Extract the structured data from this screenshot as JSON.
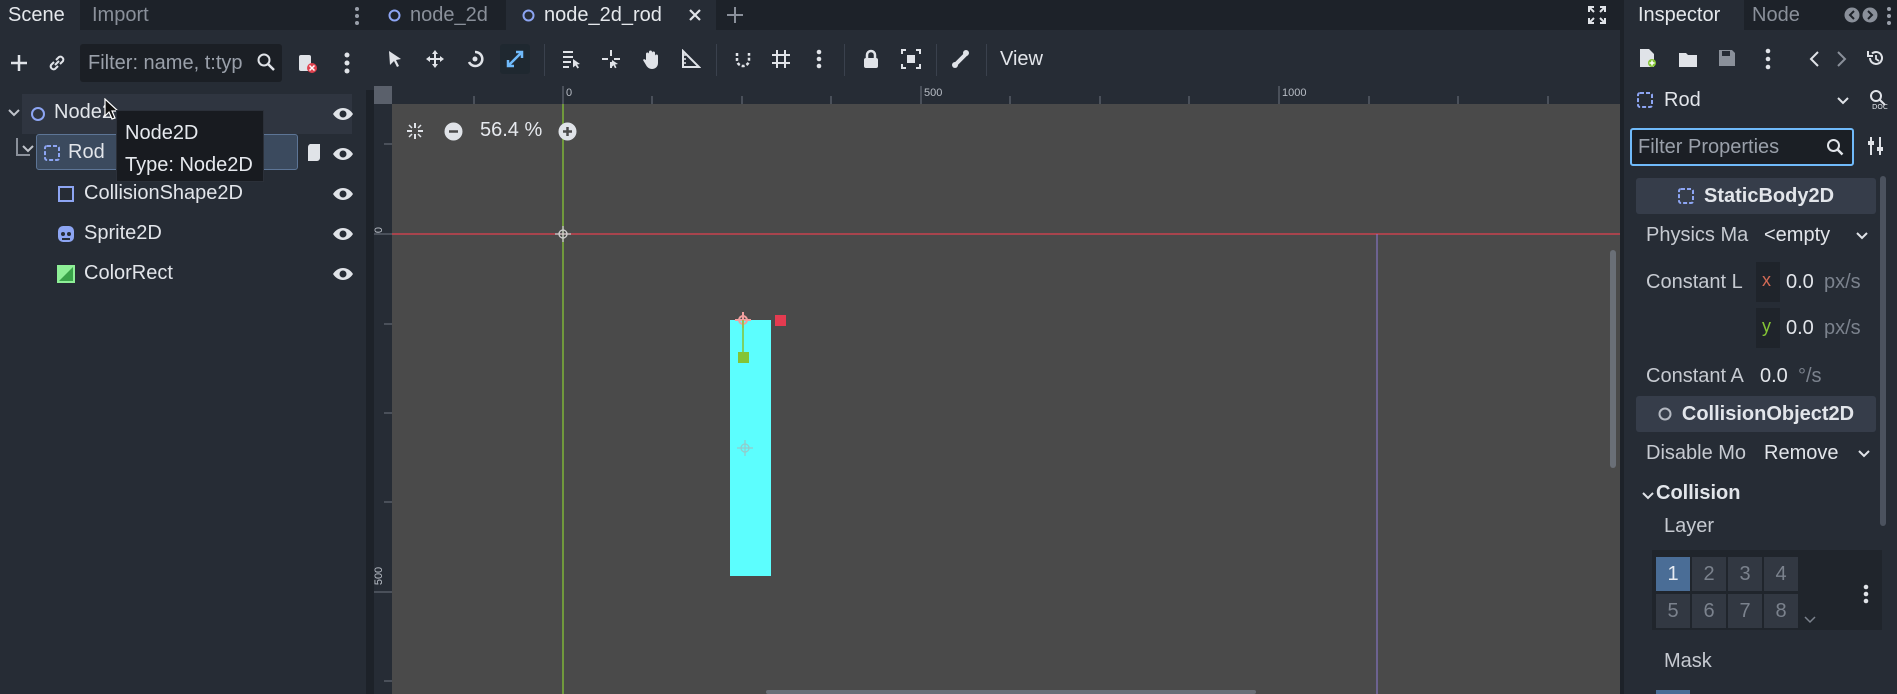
{
  "left_dock": {
    "tabs": [
      "Scene",
      "Import"
    ],
    "filter_placeholder": "Filter: name, t:typ",
    "tree": [
      {
        "label": "Node2",
        "icon": "node2d-icon"
      },
      {
        "label": "Rod",
        "icon": "staticbody2d-icon"
      },
      {
        "label": "CollisionShape2D",
        "icon": "collisionshape2d-icon"
      },
      {
        "label": "Sprite2D",
        "icon": "sprite2d-icon"
      },
      {
        "label": "ColorRect",
        "icon": "colorrect-icon"
      }
    ],
    "tooltip": {
      "line1": "Node2D",
      "line2": "Type: Node2D"
    }
  },
  "editor": {
    "scene_tabs": [
      "node_2d",
      "node_2d_rod"
    ],
    "view_menu": "View",
    "zoom_label": "56.4 %",
    "ruler_top_labels": [
      "0",
      "500",
      "1000"
    ],
    "ruler_left_labels": [
      "0",
      "500"
    ]
  },
  "inspector": {
    "tabs": [
      "Inspector",
      "Node"
    ],
    "selected_node": "Rod",
    "filter_placeholder": "Filter Properties",
    "section_staticbody": "StaticBody2D",
    "physics_material_label": "Physics Ma",
    "physics_material_value": "<empty",
    "constant_linear_label": "Constant L",
    "x_label": "x",
    "y_label": "y",
    "linear_x": "0.0",
    "linear_y": "0.0",
    "linear_unit": "px/s",
    "constant_angular_label": "Constant A",
    "angular_value": "0.0",
    "angular_unit": "°/s",
    "section_collisionobject": "CollisionObject2D",
    "disable_mode_label": "Disable Mo",
    "disable_mode_value": "Remove",
    "collision_header": "Collision",
    "layer_label": "Layer",
    "layers": [
      "1",
      "2",
      "3",
      "4",
      "5",
      "6",
      "7",
      "8"
    ],
    "mask_label": "Mask"
  },
  "colors": {
    "accent": "#70bafa",
    "rod_fill": "#5cfefe",
    "x_axis": "#e0424f",
    "y_axis": "#84c435"
  }
}
